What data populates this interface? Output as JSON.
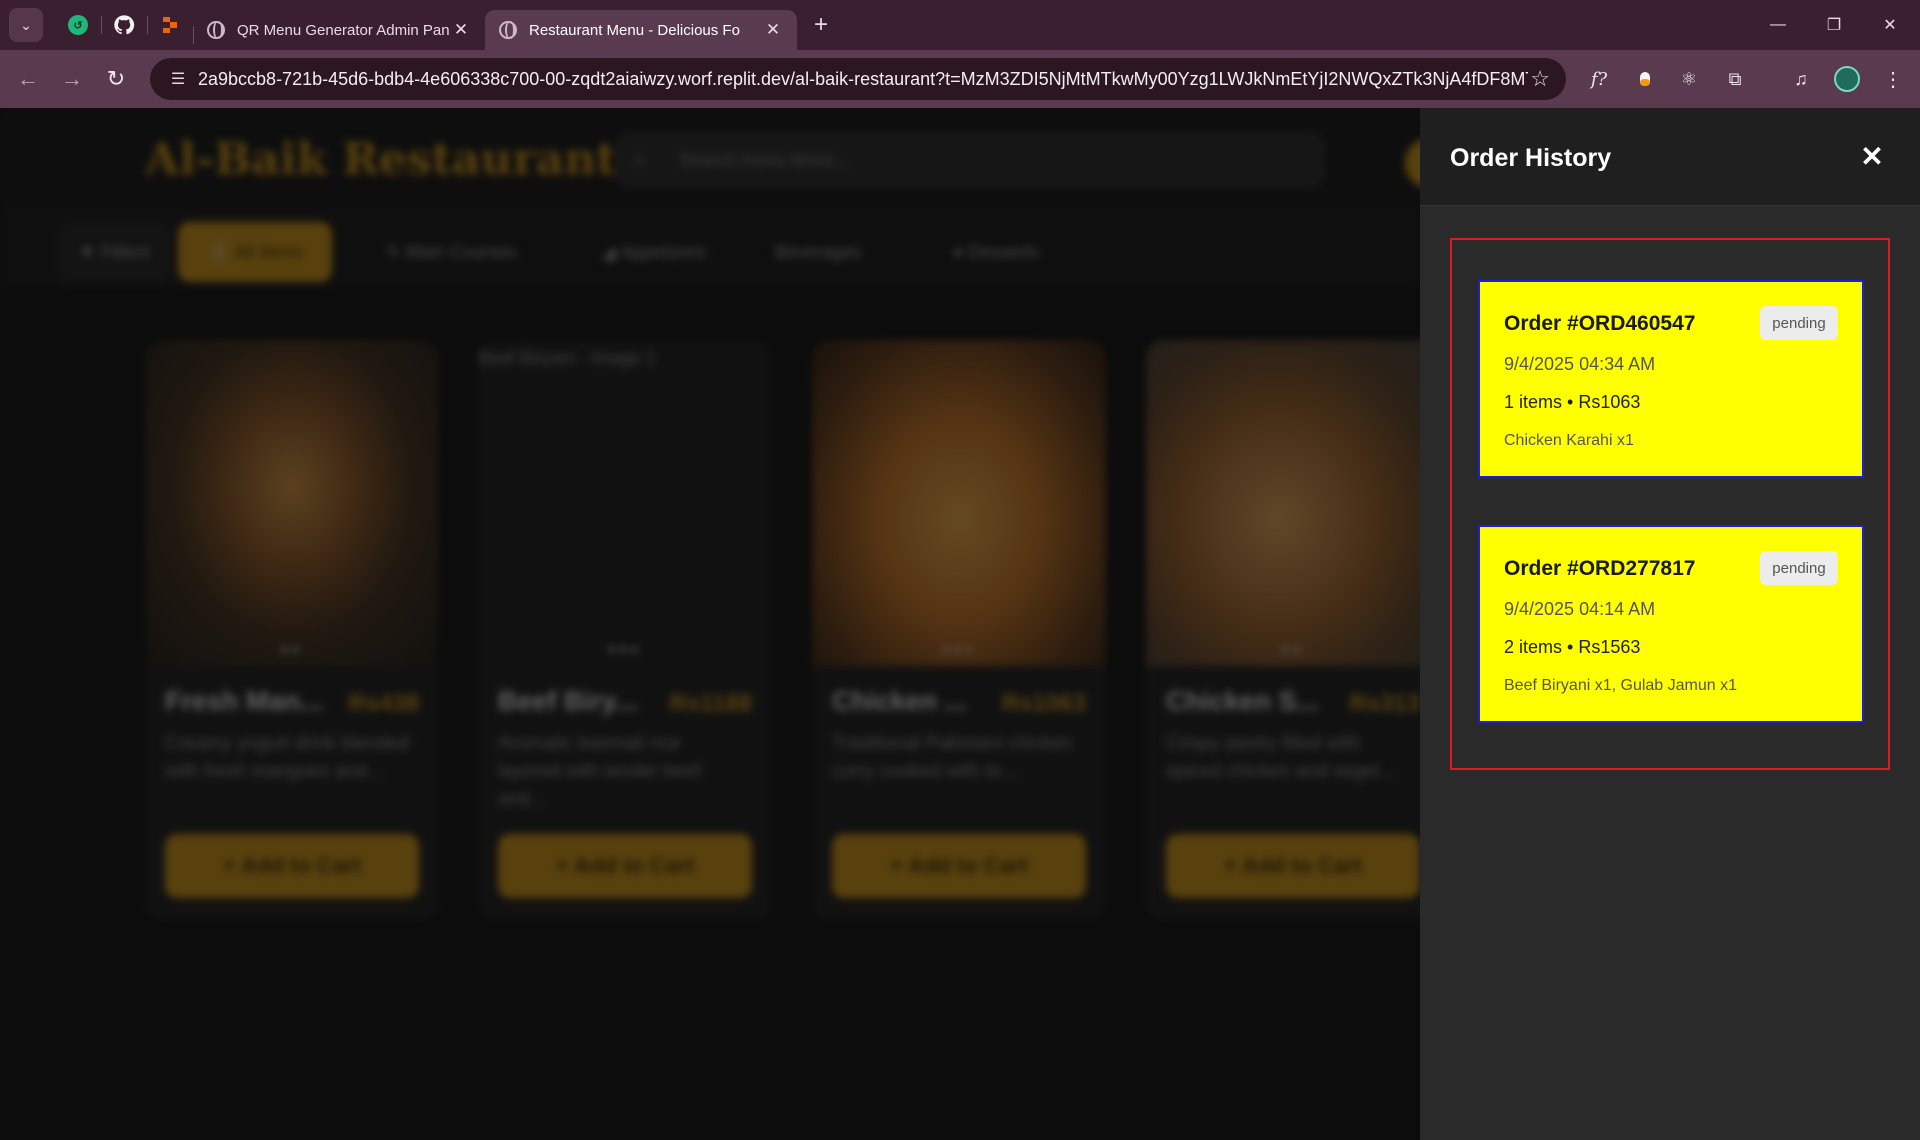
{
  "browser": {
    "tabs": [
      {
        "title": "QR Menu Generator Admin Pan",
        "active": false
      },
      {
        "title": "Restaurant Menu - Delicious Fo",
        "active": true
      }
    ],
    "url": "2a9bccb8-721b-45d6-bdb4-4e606338c700-00-zqdt2aiaiwzy.worf.replit.dev/al-baik-restaurant?t=MzM3ZDI5NjMtMTkwMy00Yzg1LWJkNmEtYjI2NWQxZTk3NjA4fDF8MTc..."
  },
  "site": {
    "brand": "Al-Baik Restaurant",
    "search_placeholder": "Search menu items...",
    "categories": [
      "Filters",
      "All Items",
      "Main Courses",
      "Appetizers",
      "Beverages",
      "Desserts"
    ],
    "cards": [
      {
        "name": "Fresh Man...",
        "price": "Rs438",
        "desc": "Creamy yogurt drink blended with fresh mangoes and...",
        "image_alt": "",
        "add_label": "+ Add to Cart"
      },
      {
        "name": "Beef Biry...",
        "price": "Rs1188",
        "desc": "Aromatic basmati rice layered with tender beef and...",
        "image_alt": "Beef Biryani - Image 1",
        "add_label": "+ Add to Cart"
      },
      {
        "name": "Chicken ...",
        "price": "Rs1063",
        "desc": "Traditional Pakistani chicken curry cooked with to...",
        "image_alt": "",
        "add_label": "+ Add to Cart"
      },
      {
        "name": "Chicken S...",
        "price": "Rs313",
        "desc": "Crispy pastry filled with spiced chicken and veget...",
        "image_alt": "",
        "add_label": "+ Add to Cart"
      }
    ]
  },
  "order_history": {
    "title": "Order History",
    "orders": [
      {
        "id": "Order #ORD460547",
        "status": "pending",
        "datetime": "9/4/2025 04:34 AM",
        "summary": "1 items • Rs1063",
        "items": "Chicken Karahi x1"
      },
      {
        "id": "Order #ORD277817",
        "status": "pending",
        "datetime": "9/4/2025 04:14 AM",
        "summary": "2 items • Rs1563",
        "items": "Beef Biryani x1, Gulab Jamun x1"
      }
    ]
  },
  "colors": {
    "accent": "#c18a10",
    "order_card": "#ffff00",
    "order_card_border": "#1d1ddc",
    "highlight_box": "#e0191f"
  }
}
